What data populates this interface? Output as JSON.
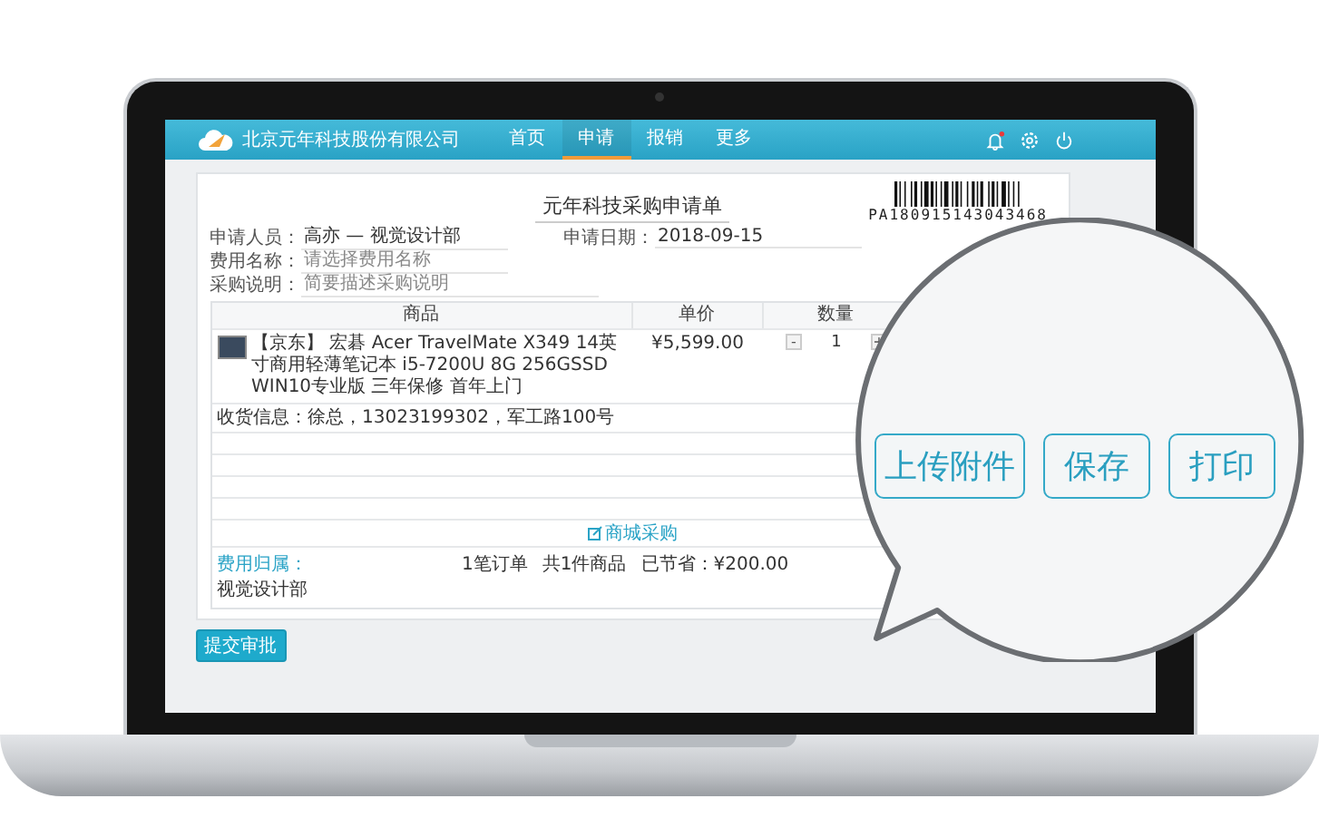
{
  "company": "北京元年科技股份有限公司",
  "nav": [
    {
      "label": "首页",
      "selected": false
    },
    {
      "label": "申请",
      "selected": true
    },
    {
      "label": "报销",
      "selected": false
    },
    {
      "label": "更多",
      "selected": false
    }
  ],
  "notifications": {
    "unread": true
  },
  "form": {
    "title": "元年科技采购申请单",
    "barcode": "PA180915143043468",
    "fields": [
      {
        "label": "申请人员：",
        "value": "高亦 — 视觉设计部"
      },
      {
        "label": "费用名称：",
        "placeholder": "请选择费用名称"
      },
      {
        "label": "采购说明：",
        "placeholder": "简要描述采购说明"
      }
    ],
    "date": {
      "label": "申请日期：",
      "value": "2018-09-15"
    }
  },
  "table": {
    "columns": [
      "商品",
      "单价",
      "数量"
    ],
    "rows": [
      {
        "product": "【京东】 宏碁 Acer TravelMate X349 14英寸商用轻薄笔记本 i5-7200U 8G 256GSSD WIN10专业版 三年保修 首年上门",
        "price": "¥5,599.00",
        "quantity": "1",
        "minus": "-",
        "plus": "+"
      }
    ],
    "shipping": "收货信息：徐总，13023199302，军工路100号",
    "mall_link": "商城采购"
  },
  "footer": {
    "attribution_label": "费用归属：",
    "attribution_value": "视觉设计部",
    "orders": "1笔订单",
    "items": "共1件商品",
    "savings": "已节省：¥200.00"
  },
  "submit": "提交审批",
  "callout": {
    "buttons": [
      "上传附件",
      "保存",
      "打印"
    ]
  }
}
